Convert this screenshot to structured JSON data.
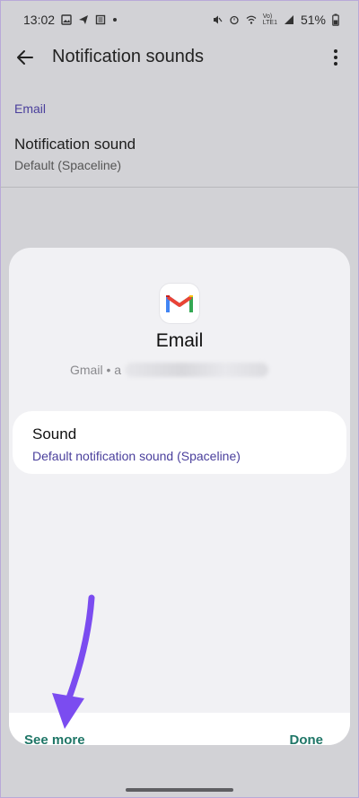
{
  "status_bar": {
    "time": "13:02",
    "battery": "51%",
    "icons_left": [
      "image-icon",
      "telegram-icon",
      "news-icon",
      "dot-icon"
    ],
    "icons_right": [
      "mute-icon",
      "alarm-icon",
      "wifi-icon",
      "volte-icon",
      "signal-icon",
      "battery-icon"
    ],
    "network_label_top": "Vo)",
    "network_label_bottom": "LTE1"
  },
  "app_bar": {
    "title": "Notification sounds",
    "back_icon": "back-arrow-icon",
    "more_icon": "more-vert-icon"
  },
  "section": {
    "header": "Email",
    "item_title": "Notification sound",
    "item_subtitle": "Default (Spaceline)"
  },
  "sheet": {
    "app_icon": "gmail-icon",
    "app_name": "Email",
    "account_prefix": "Gmail • a",
    "sound_card": {
      "title": "Sound",
      "subtitle": "Default notification sound (Spaceline)"
    },
    "see_more_label": "See more",
    "done_label": "Done"
  },
  "colors": {
    "accent_purple": "#4a3f9c",
    "button_teal": "#1f7667",
    "annotation_arrow": "#7b4cf0",
    "dim_background": "#d2d2d6",
    "sheet_background": "#f1f1f4"
  }
}
